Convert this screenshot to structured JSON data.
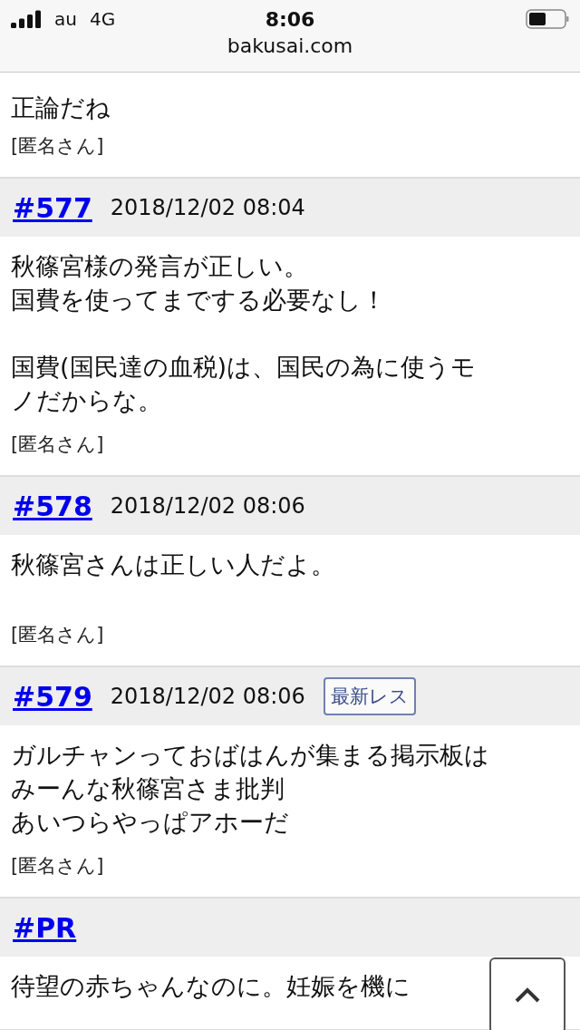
{
  "status_bar": {
    "carrier": "au",
    "network": "4G",
    "time": "8:06",
    "url": "bakusai.com"
  },
  "posts": [
    {
      "paragraphs": [
        [
          "正論だね"
        ]
      ],
      "author": "[匿名さん]"
    },
    {
      "number": "#577",
      "date": "2018/12/02 08:04",
      "paragraphs": [
        [
          "秋篠宮様の発言が正しい。",
          "国費を使ってまでする必要なし！"
        ],
        [
          "国費(国民達の血税)は、国民の為に使うモ",
          "ノだからな。"
        ]
      ],
      "author": "[匿名さん]"
    },
    {
      "number": "#578",
      "date": "2018/12/02 08:06",
      "paragraphs": [
        [
          "秋篠宮さんは正しい人だよ。"
        ]
      ],
      "author": "[匿名さん]"
    },
    {
      "number": "#579",
      "date": "2018/12/02 08:06",
      "badge": "最新レス",
      "paragraphs": [
        [
          "ガルチャンっておばはんが集まる掲示板は",
          "みーんな秋篠宮さま批判",
          "あいつらやっぱアホーだ"
        ]
      ],
      "author": "[匿名さん]"
    },
    {
      "number": "#PR",
      "paragraphs": [
        [
          "待望の赤ちゃんなのに。妊娠を機に"
        ]
      ]
    }
  ]
}
